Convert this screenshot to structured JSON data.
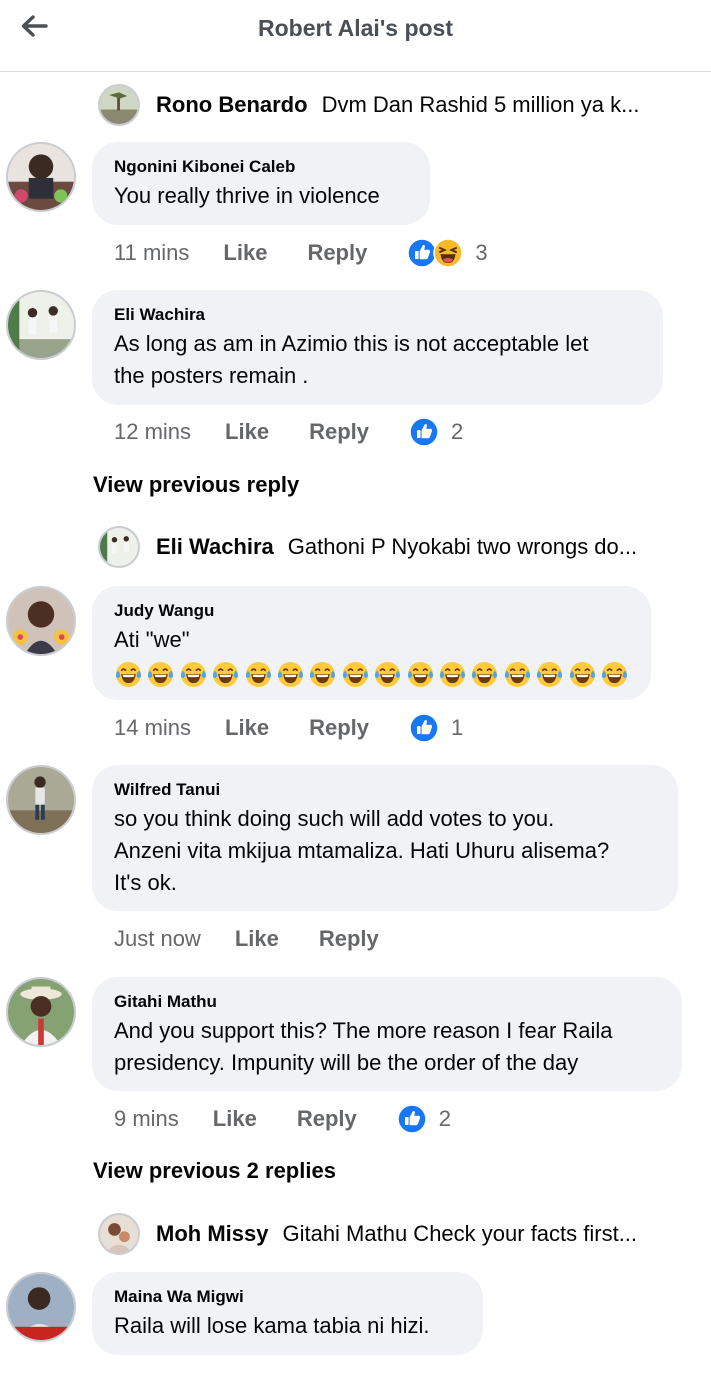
{
  "header": {
    "title": "Robert Alai's post",
    "back_icon": "arrow-left-icon"
  },
  "reply_previews": [
    {
      "name": "Rono Benardo",
      "text": "Dvm Dan Rashid 5 million ya k..."
    },
    {
      "name": "Eli Wachira",
      "text": "Gathoni P Nyokabi two wrongs do..."
    },
    {
      "name": "Moh Missy",
      "text": "Gitahi Mathu Check your facts first..."
    }
  ],
  "comments": [
    {
      "author": "Ngonini Kibonei Caleb",
      "text": "You really thrive in violence",
      "time": "11 mins",
      "like": "Like",
      "reply": "Reply",
      "reaction_count": "3",
      "reactions": [
        "like-reaction-icon",
        "haha-reaction-icon"
      ]
    },
    {
      "author": "Eli Wachira",
      "text_lines": [
        "As long as am in Azimio this is not acceptable let",
        "the posters remain ."
      ],
      "time": "12 mins",
      "like": "Like",
      "reply": "Reply",
      "reaction_count": "2",
      "reactions": [
        "like-reaction-icon"
      ]
    },
    {
      "author": "Judy Wangu",
      "text": "Ati \"we\"",
      "emoji_count": 16,
      "emoji": "face-with-tears-of-joy",
      "time": "14 mins",
      "like": "Like",
      "reply": "Reply",
      "reaction_count": "1",
      "reactions": [
        "like-reaction-icon"
      ]
    },
    {
      "author": "Wilfred Tanui",
      "text_lines": [
        "so you think doing such will add votes to you.",
        "Anzeni vita mkijua mtamaliza. Hati Uhuru alisema?",
        "It's ok."
      ],
      "time": "Just now",
      "like": "Like",
      "reply": "Reply"
    },
    {
      "author": "Gitahi Mathu",
      "text_lines": [
        "And you support this?  The more reason I fear Raila",
        "presidency. Impunity will be the order of the day"
      ],
      "time": "9 mins",
      "like": "Like",
      "reply": "Reply",
      "reaction_count": "2",
      "reactions": [
        "like-reaction-icon"
      ]
    },
    {
      "author": "Maina Wa Migwi",
      "text": "Raila will lose kama tabia ni hizi."
    }
  ],
  "view_previous": [
    "View previous reply",
    "View previous 2 replies"
  ],
  "colors": {
    "like_blue": "#1877f2",
    "bubble_bg": "#f0f2f5",
    "meta_gray": "#65676b",
    "haha_yellow": "#f7b928"
  }
}
